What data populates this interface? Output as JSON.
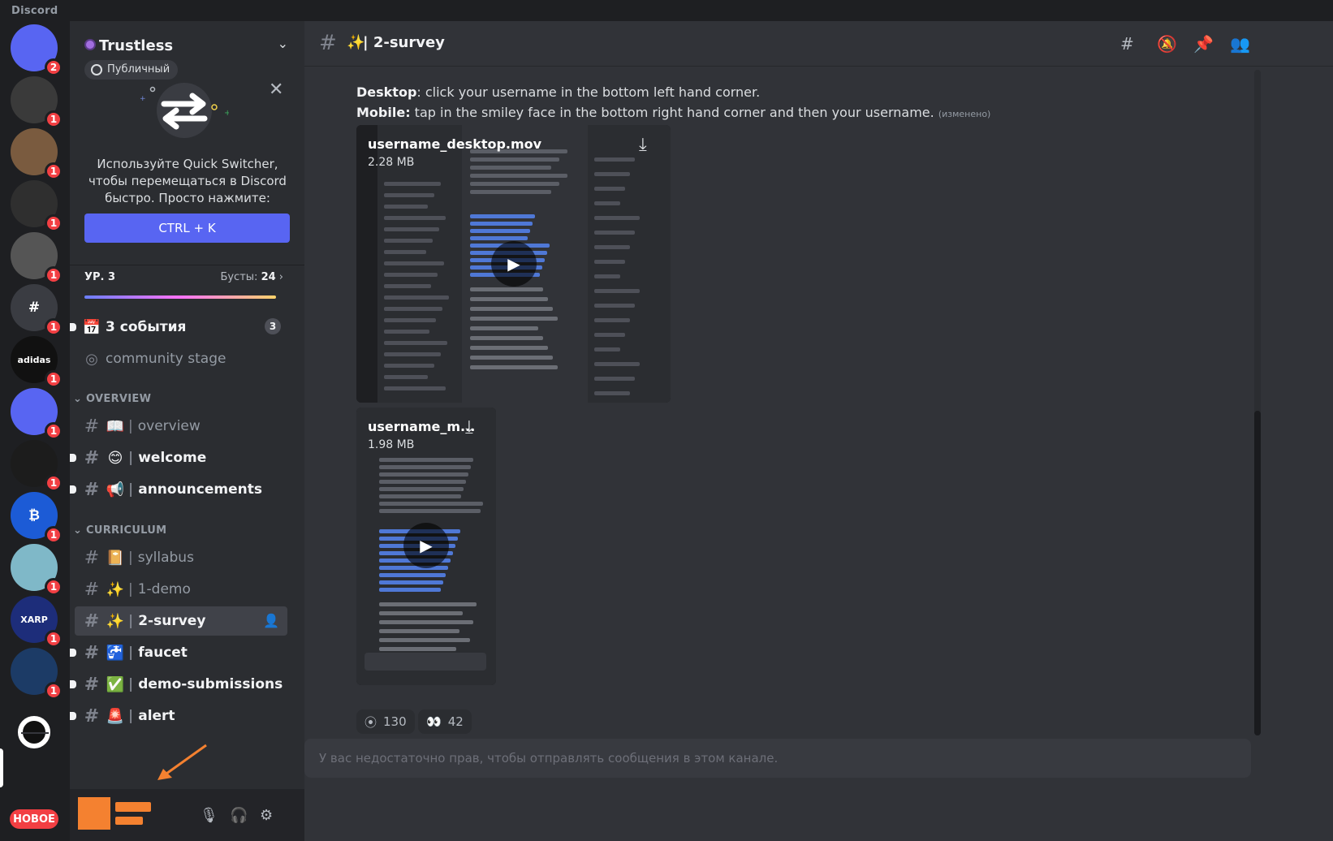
{
  "app": {
    "brand": "Discord"
  },
  "rail": {
    "servers": [
      {
        "name": "discord-home",
        "badge": "2",
        "color": "#5865f2"
      },
      {
        "name": "server-skull",
        "badge": "1",
        "color": "#3a3a3a"
      },
      {
        "name": "server-warrior",
        "badge": "1",
        "color": "#7a5b3f"
      },
      {
        "name": "server-red-hat",
        "badge": "1",
        "color": "#2f2f2f"
      },
      {
        "name": "server-portrait",
        "badge": "1",
        "color": "#555555"
      },
      {
        "name": "server-hash",
        "badge": "1",
        "color": "#3a3c42",
        "label": "#"
      },
      {
        "name": "server-adidas",
        "badge": "1",
        "color": "#111111",
        "label": "adidas"
      },
      {
        "name": "server-discord-2",
        "badge": "1",
        "color": "#5865f2"
      },
      {
        "name": "server-red-v",
        "badge": "1",
        "color": "#1c1c1c"
      },
      {
        "name": "server-bitcoin",
        "badge": "1",
        "color": "#1c5bd6",
        "label": "₿"
      },
      {
        "name": "server-creature",
        "badge": "1",
        "color": "#7fb8c8"
      },
      {
        "name": "server-xarpon",
        "badge": "1",
        "color": "#1d2d7a",
        "label": "XARP"
      },
      {
        "name": "server-shield",
        "badge": "1",
        "color": "#1c3b66"
      },
      {
        "name": "server-trustless",
        "badge": "",
        "color": "#111111"
      }
    ],
    "new_label": "НОВОЕ"
  },
  "sidebar": {
    "server_name": "Trustless",
    "public_label": "Публичный",
    "quick_switcher_text": "Используйте Quick Switcher, чтобы перемещаться в Discord быстро. Просто нажмите:",
    "quick_switcher_button": "CTRL + K",
    "level_label": "УР. 3",
    "boosts_label": "Бусты:",
    "boosts_value": "24",
    "events": {
      "label": "3 события",
      "count": "3"
    },
    "community_stage": "community stage",
    "categories": [
      {
        "name": "OVERVIEW"
      },
      {
        "name": "CURRICULUM"
      }
    ],
    "overview_channels": [
      {
        "emoji": "📖",
        "name": "overview",
        "unread": false
      },
      {
        "emoji": "😊",
        "name": "welcome",
        "unread": true
      },
      {
        "emoji": "📢",
        "name": "announcements",
        "unread": true
      }
    ],
    "curriculum_channels": [
      {
        "emoji": "📔",
        "name": "syllabus",
        "unread": false
      },
      {
        "emoji": "✨",
        "name": "1-demo",
        "unread": false
      },
      {
        "emoji": "✨",
        "name": "2-survey",
        "unread": false,
        "active": true
      },
      {
        "emoji": "🚰",
        "name": "faucet",
        "unread": true
      },
      {
        "emoji": "✅",
        "name": "demo-submissions",
        "unread": true
      },
      {
        "emoji": "🚨",
        "name": "alert",
        "unread": true
      }
    ]
  },
  "header": {
    "channel_emoji": "✨",
    "channel_name": "2-survey"
  },
  "message": {
    "desktop_label": "Desktop",
    "desktop_text": ": click your username in the bottom left hand corner.",
    "mobile_label": "Mobile:",
    "mobile_text": " tap in the smiley face in the bottom right hand corner and then your username.",
    "edited": "(изменено)",
    "videos": [
      {
        "name": "username_desktop.mov",
        "size": "2.28 MB"
      },
      {
        "name": "username_m...",
        "size": "1.98 MB"
      }
    ],
    "reactions": [
      {
        "emoji": "⦿",
        "count": "130"
      },
      {
        "emoji": "👀",
        "count": "42"
      }
    ]
  },
  "composer": {
    "placeholder": "У вас недостаточно прав, чтобы отправлять сообщения в этом канале."
  },
  "colors": {
    "accent": "#5865f2",
    "unread_badge": "#f23f43",
    "user_avatar": "#f48130"
  }
}
